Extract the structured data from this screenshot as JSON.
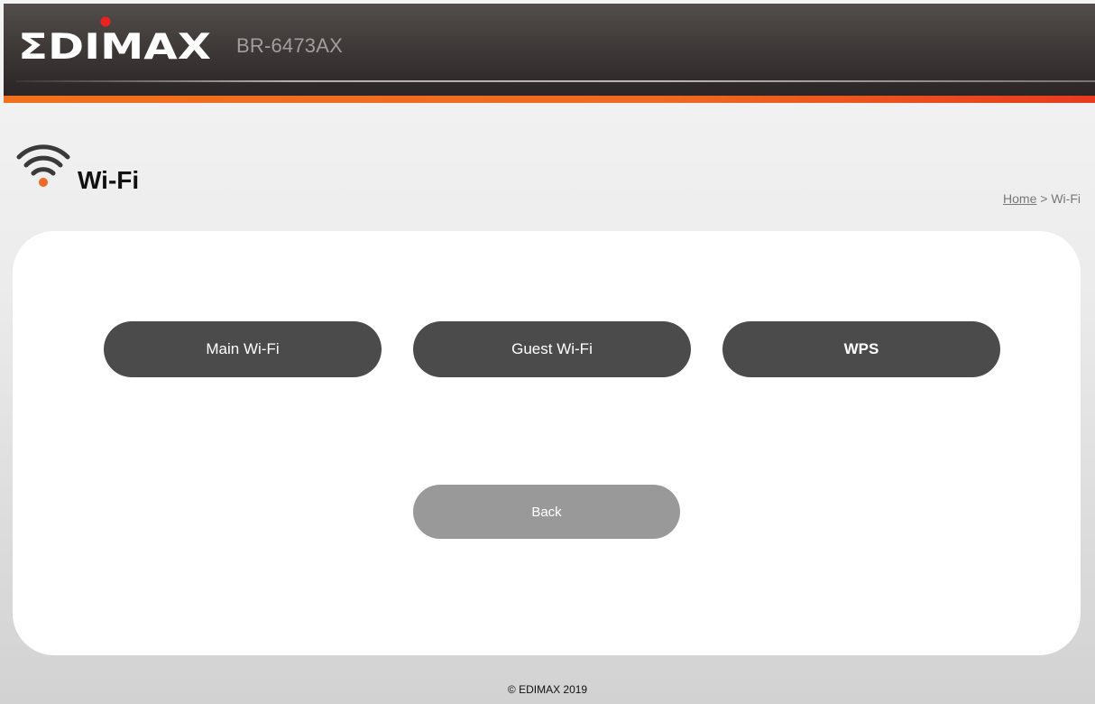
{
  "header": {
    "brand": "EDIMAX",
    "model": "BR-6473AX",
    "colors": {
      "orange_bar": "#f0701e",
      "logo_dot": "#e8231f"
    }
  },
  "page": {
    "title": "Wi-Fi",
    "icon": "wifi-icon"
  },
  "breadcrumb": {
    "home": "Home",
    "separator": " > ",
    "current": "Wi-Fi"
  },
  "menu": {
    "main_wifi": "Main Wi-Fi",
    "guest_wifi": "Guest Wi-Fi",
    "wps": "WPS"
  },
  "actions": {
    "back": "Back"
  },
  "footer": {
    "copyright": "© EDIMAX 2019"
  }
}
